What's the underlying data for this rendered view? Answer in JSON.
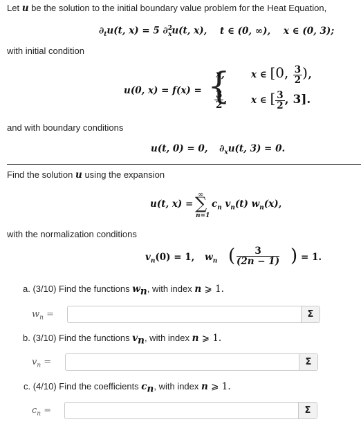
{
  "intro": {
    "text_before": "Let ",
    "var_u": "u",
    "text_after": " be the solution to the initial boundary value problem for the Heat Equation,"
  },
  "pde": {
    "lhs": "∂",
    "lhs_sub": "t",
    "lhs_rest": "u(t, x) = 5 ∂",
    "rhs_sup": "2",
    "rhs_sub": "x",
    "rhs_rest": "u(t, x),",
    "t_domain": "t ∈ (0, ∞),",
    "x_domain": "x ∈ (0, 3);"
  },
  "initial_condition_label": "with initial condition",
  "initial_condition": {
    "lhs": "u(0, x) = f(x) =",
    "case1_value": "x,",
    "case1_domain_prefix": "x ∈ ",
    "case1_interval_open": "[0, ",
    "case1_frac_num": "3",
    "case1_frac_den": "2",
    "case1_interval_close": "),",
    "case2_frac_num": "3",
    "case2_frac_den": "2",
    "case2_comma": ",",
    "case2_domain_prefix": "x ∈ ",
    "case2_interval_open": "[",
    "case2_interval_frac_num": "3",
    "case2_interval_frac_den": "2",
    "case2_interval_close": ", 3].",
    "brace": "{"
  },
  "boundary_label": "and with boundary conditions",
  "boundary": {
    "left": "u(t, 0) = 0,",
    "right_prefix": "∂",
    "right_sub": "x",
    "right_rest": "u(t, 3) = 0."
  },
  "expansion_label_before": "Find the solution ",
  "expansion_label_var": "u",
  "expansion_label_after": " using the expansion",
  "expansion": {
    "lhs": "u(t, x) =",
    "sum_top": "∞",
    "sum_symbol": "∑",
    "sum_bottom": "n=1",
    "rhs_c": "c",
    "rhs_v": " v",
    "rhs_v_arg": "(t)",
    "rhs_w": " w",
    "rhs_w_arg": "(x),",
    "sub_n": "n"
  },
  "normalization_label": "with the normalization conditions",
  "normalization": {
    "v": "v",
    "v_sub": "n",
    "v_rest": "(0) = 1,",
    "w": "w",
    "w_sub": "n",
    "w_frac_num": "3",
    "w_frac_den": "(2n − 1)",
    "w_rest": "= 1."
  },
  "parts": [
    {
      "prefix": "a. (3/10) Find the functions ",
      "var": "w",
      "var_sub": "n",
      "suffix": ", with index ",
      "n": "n",
      "cond": " ⩾ 1.",
      "label_var": "w",
      "label_sub": "n",
      "label_eq": " =",
      "value": "",
      "button_label": "Σ"
    },
    {
      "prefix": "b. (3/10) Find the functions ",
      "var": "v",
      "var_sub": "n",
      "suffix": ", with index ",
      "n": "n",
      "cond": " ⩾ 1.",
      "label_var": "v",
      "label_sub": "n",
      "label_eq": " =",
      "value": "",
      "button_label": "Σ"
    },
    {
      "prefix": "c. (4/10) Find the coefficients ",
      "var": "c",
      "var_sub": "n",
      "suffix": ", with index ",
      "n": "n",
      "cond": " ⩾ 1.",
      "label_var": "c",
      "label_sub": "n",
      "label_eq": " =",
      "value": "",
      "button_label": "Σ"
    }
  ]
}
